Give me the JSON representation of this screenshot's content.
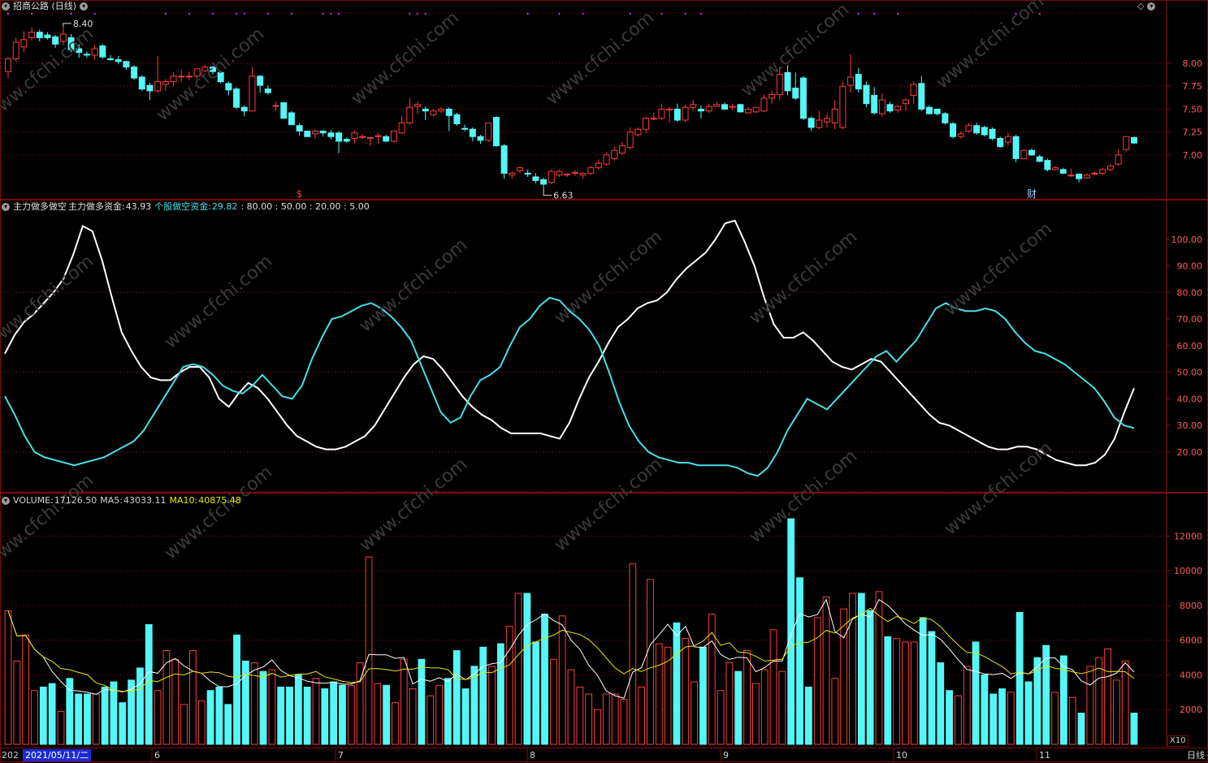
{
  "app": {
    "stock_title": "招商公路 (日线)",
    "period_tab": "日线",
    "date_prefix": "202",
    "cursor_date": "2021/05/11/二",
    "volume_multiplier": "X10",
    "month_labels": [
      "6",
      "7",
      "8",
      "9",
      "10",
      "11"
    ],
    "colors": {
      "up": "#ff3b3b",
      "down": "#54f7f7",
      "grid": "#8a1010",
      "line_white": "#ffffff",
      "ma10": "#e8e800",
      "axis_text": "#ff5a5a"
    }
  },
  "price_panel": {
    "high_label": "8.40",
    "low_label": "6.63",
    "event_marker": "$",
    "fin_marker": "财"
  },
  "indicator_panel": {
    "name": "主力做多做空",
    "s1_label": "主力做多资金:",
    "s1_value": "43.93",
    "s2_label": "个股做空资金:",
    "s2_value": "29.82",
    "levels": ": 80.00 : 50.00 : 20.00 : 5.00"
  },
  "volume_panel": {
    "label": "VOLUME:",
    "value": "17126.50",
    "ma5_label": "MA5:",
    "ma5_value": "43033.11",
    "ma10_label": "MA10:",
    "ma10_value": "40875.48"
  },
  "chart_data": [
    {
      "type": "candlestick",
      "title": "招商公路 (日线)",
      "y_ticks": [
        7.0,
        7.25,
        7.5,
        7.75,
        8.0
      ],
      "ylim": [
        6.52,
        8.55
      ],
      "annotations": {
        "high": 8.4,
        "low": 6.63
      },
      "candles": [
        [
          7.91,
          8.05,
          7.84,
          8.07
        ],
        [
          8.05,
          8.23,
          8.02,
          8.28
        ],
        [
          8.18,
          8.26,
          8.12,
          8.35
        ],
        [
          8.28,
          8.34,
          8.25,
          8.39
        ],
        [
          8.34,
          8.28,
          8.24,
          8.37
        ],
        [
          8.31,
          8.28,
          8.26,
          8.34
        ],
        [
          8.29,
          8.21,
          8.17,
          8.31
        ],
        [
          8.24,
          8.32,
          8.2,
          8.4
        ],
        [
          8.28,
          8.15,
          8.12,
          8.32
        ],
        [
          8.16,
          8.12,
          8.06,
          8.21
        ],
        [
          8.1,
          8.09,
          8.06,
          8.13
        ],
        [
          8.09,
          8.16,
          8.04,
          8.2
        ],
        [
          8.19,
          8.07,
          8.05,
          8.21
        ],
        [
          8.05,
          8.04,
          8.03,
          8.09
        ],
        [
          8.04,
          8.02,
          7.99,
          8.08
        ],
        [
          8.02,
          7.96,
          7.93,
          8.03
        ],
        [
          7.96,
          7.84,
          7.82,
          7.98
        ],
        [
          7.85,
          7.72,
          7.7,
          7.87
        ],
        [
          7.76,
          7.7,
          7.6,
          7.79
        ],
        [
          7.7,
          7.8,
          7.68,
          8.08
        ],
        [
          7.77,
          7.8,
          7.7,
          7.83
        ],
        [
          7.8,
          7.86,
          7.75,
          7.9
        ],
        [
          7.86,
          7.86,
          7.8,
          7.93
        ],
        [
          7.86,
          7.86,
          7.82,
          7.91
        ],
        [
          7.86,
          7.94,
          7.83,
          7.94
        ],
        [
          7.92,
          7.96,
          7.9,
          7.98
        ],
        [
          7.96,
          7.91,
          7.88,
          7.97
        ],
        [
          7.9,
          7.8,
          7.78,
          7.92
        ],
        [
          7.78,
          7.71,
          7.65,
          7.8
        ],
        [
          7.72,
          7.52,
          7.5,
          7.74
        ],
        [
          7.52,
          7.48,
          7.42,
          7.54
        ],
        [
          7.48,
          7.86,
          7.48,
          7.96
        ],
        [
          7.86,
          7.76,
          7.68,
          7.87
        ],
        [
          7.72,
          7.68,
          7.66,
          7.76
        ],
        [
          7.54,
          7.54,
          7.48,
          7.58
        ],
        [
          7.57,
          7.4,
          7.4,
          7.58
        ],
        [
          7.46,
          7.33,
          7.33,
          7.48
        ],
        [
          7.32,
          7.26,
          7.21,
          7.35
        ],
        [
          7.26,
          7.2,
          7.2,
          7.26
        ],
        [
          7.23,
          7.26,
          7.18,
          7.28
        ],
        [
          7.26,
          7.24,
          7.2,
          7.27
        ],
        [
          7.24,
          7.2,
          7.17,
          7.27
        ],
        [
          7.24,
          7.15,
          7.02,
          7.26
        ],
        [
          7.17,
          7.15,
          7.13,
          7.19
        ],
        [
          7.18,
          7.24,
          7.13,
          7.27
        ],
        [
          7.19,
          7.2,
          7.17,
          7.23
        ],
        [
          7.18,
          7.19,
          7.1,
          7.2
        ],
        [
          7.2,
          7.21,
          7.12,
          7.24
        ],
        [
          7.2,
          7.15,
          7.14,
          7.22
        ],
        [
          7.15,
          7.26,
          7.13,
          7.26
        ],
        [
          7.24,
          7.35,
          7.23,
          7.43
        ],
        [
          7.35,
          7.52,
          7.33,
          7.62
        ],
        [
          7.53,
          7.55,
          7.45,
          7.58
        ],
        [
          7.5,
          7.48,
          7.38,
          7.53
        ],
        [
          7.44,
          7.48,
          7.42,
          7.5
        ],
        [
          7.48,
          7.5,
          7.46,
          7.52
        ],
        [
          7.5,
          7.43,
          7.26,
          7.52
        ],
        [
          7.44,
          7.34,
          7.32,
          7.46
        ],
        [
          7.29,
          7.28,
          7.26,
          7.33
        ],
        [
          7.28,
          7.2,
          7.15,
          7.3
        ],
        [
          7.2,
          7.16,
          7.12,
          7.22
        ],
        [
          7.16,
          7.35,
          7.14,
          7.35
        ],
        [
          7.41,
          7.1,
          7.09,
          7.42
        ],
        [
          7.1,
          6.8,
          6.74,
          7.12
        ],
        [
          6.78,
          6.8,
          6.74,
          6.82
        ],
        [
          6.83,
          6.86,
          6.8,
          6.87
        ],
        [
          6.8,
          6.79,
          6.76,
          6.84
        ],
        [
          6.76,
          6.72,
          6.69,
          6.8
        ],
        [
          6.73,
          6.68,
          6.63,
          6.75
        ],
        [
          6.7,
          6.82,
          6.68,
          6.84
        ],
        [
          6.78,
          6.82,
          6.76,
          6.84
        ],
        [
          6.79,
          6.79,
          6.76,
          6.8
        ],
        [
          6.8,
          6.81,
          6.77,
          6.83
        ],
        [
          6.78,
          6.8,
          6.74,
          6.81
        ],
        [
          6.8,
          6.86,
          6.78,
          6.88
        ],
        [
          6.86,
          6.91,
          6.84,
          6.95
        ],
        [
          6.9,
          7.0,
          6.88,
          7.03
        ],
        [
          6.96,
          7.05,
          6.94,
          7.09
        ],
        [
          7.02,
          7.1,
          7.0,
          7.14
        ],
        [
          7.08,
          7.25,
          7.06,
          7.3
        ],
        [
          7.22,
          7.28,
          7.2,
          7.3
        ],
        [
          7.28,
          7.4,
          7.24,
          7.42
        ],
        [
          7.4,
          7.4,
          7.38,
          7.46
        ],
        [
          7.4,
          7.5,
          7.38,
          7.56
        ],
        [
          7.5,
          7.5,
          7.35,
          7.52
        ],
        [
          7.5,
          7.38,
          7.36,
          7.56
        ],
        [
          7.38,
          7.52,
          7.36,
          7.55
        ],
        [
          7.52,
          7.55,
          7.48,
          7.6
        ],
        [
          7.5,
          7.48,
          7.4,
          7.54
        ],
        [
          7.48,
          7.53,
          7.46,
          7.56
        ],
        [
          7.53,
          7.55,
          7.52,
          7.58
        ],
        [
          7.55,
          7.5,
          7.49,
          7.57
        ],
        [
          7.52,
          7.53,
          7.49,
          7.56
        ],
        [
          7.55,
          7.47,
          7.46,
          7.56
        ],
        [
          7.46,
          7.5,
          7.45,
          7.52
        ],
        [
          7.47,
          7.52,
          7.46,
          7.52
        ],
        [
          7.48,
          7.62,
          7.47,
          7.66
        ],
        [
          7.62,
          7.66,
          7.56,
          7.7
        ],
        [
          7.66,
          7.88,
          7.6,
          7.96
        ],
        [
          7.9,
          7.7,
          7.65,
          7.98
        ],
        [
          7.73,
          7.62,
          7.6,
          7.9
        ],
        [
          7.84,
          7.4,
          7.38,
          7.86
        ],
        [
          7.4,
          7.3,
          7.26,
          7.42
        ],
        [
          7.3,
          7.38,
          7.28,
          7.48
        ],
        [
          7.36,
          7.4,
          7.3,
          7.45
        ],
        [
          7.35,
          7.5,
          7.28,
          7.6
        ],
        [
          7.3,
          7.75,
          7.28,
          7.8
        ],
        [
          7.76,
          7.85,
          7.68,
          8.1
        ],
        [
          7.88,
          7.72,
          7.68,
          7.95
        ],
        [
          7.76,
          7.56,
          7.52,
          7.8
        ],
        [
          7.65,
          7.46,
          7.44,
          7.74
        ],
        [
          7.45,
          7.6,
          7.42,
          7.67
        ],
        [
          7.55,
          7.48,
          7.46,
          7.58
        ],
        [
          7.49,
          7.53,
          7.46,
          7.54
        ],
        [
          7.56,
          7.6,
          7.48,
          7.62
        ],
        [
          7.65,
          7.77,
          7.56,
          7.8
        ],
        [
          7.78,
          7.5,
          7.48,
          7.86
        ],
        [
          7.52,
          7.45,
          7.44,
          7.54
        ],
        [
          7.5,
          7.45,
          7.43,
          7.5
        ],
        [
          7.45,
          7.35,
          7.33,
          7.47
        ],
        [
          7.34,
          7.2,
          7.18,
          7.36
        ],
        [
          7.2,
          7.23,
          7.18,
          7.26
        ],
        [
          7.26,
          7.32,
          7.24,
          7.35
        ],
        [
          7.32,
          7.24,
          7.22,
          7.35
        ],
        [
          7.3,
          7.22,
          7.2,
          7.32
        ],
        [
          7.28,
          7.18,
          7.16,
          7.3
        ],
        [
          7.18,
          7.09,
          7.08,
          7.2
        ],
        [
          7.14,
          7.2,
          7.1,
          7.24
        ],
        [
          7.2,
          6.96,
          6.92,
          7.22
        ],
        [
          6.96,
          7.05,
          6.95,
          7.06
        ],
        [
          7.05,
          7.0,
          6.99,
          7.07
        ],
        [
          6.98,
          6.93,
          6.92,
          7.0
        ],
        [
          6.94,
          6.84,
          6.82,
          6.96
        ],
        [
          6.84,
          6.86,
          6.83,
          6.88
        ],
        [
          6.84,
          6.8,
          6.79,
          6.86
        ],
        [
          6.78,
          6.78,
          6.76,
          6.85
        ],
        [
          6.79,
          6.74,
          6.7,
          6.8
        ],
        [
          6.75,
          6.78,
          6.74,
          6.8
        ],
        [
          6.8,
          6.8,
          6.78,
          6.82
        ],
        [
          6.8,
          6.84,
          6.78,
          6.86
        ],
        [
          6.84,
          6.88,
          6.82,
          6.9
        ],
        [
          6.9,
          7.0,
          6.88,
          7.06
        ],
        [
          7.06,
          7.2,
          7.04,
          7.2
        ],
        [
          7.19,
          7.13,
          7.12,
          7.2
        ]
      ]
    },
    {
      "type": "line",
      "title": "主力做多做空",
      "y_ticks": [
        20,
        30,
        40,
        50,
        60,
        70,
        80,
        90,
        100
      ],
      "ylim": [
        5,
        110
      ],
      "reference_levels": [
        80,
        50,
        20,
        5
      ],
      "series": [
        {
          "name": "主力做多资金",
          "color": "#ffffff",
          "values": [
            57,
            64,
            69,
            72,
            76,
            80,
            85,
            94,
            105,
            103,
            92,
            78,
            65,
            58,
            52,
            48,
            47,
            47,
            50,
            52,
            52,
            48,
            40,
            37,
            42,
            46,
            44,
            40,
            35,
            30,
            26,
            24,
            22,
            21,
            21,
            22,
            24,
            26,
            30,
            36,
            42,
            48,
            53,
            56,
            55,
            51,
            46,
            41,
            37,
            34,
            32,
            29,
            27,
            27,
            27,
            27,
            26,
            25,
            31,
            40,
            48,
            54,
            61,
            67,
            70,
            74,
            76,
            77,
            80,
            85,
            89,
            92,
            95,
            100,
            106,
            107,
            99,
            90,
            78,
            68,
            63,
            63,
            65,
            62,
            58,
            54,
            52,
            51,
            53,
            55,
            54,
            50,
            46,
            42,
            38,
            34,
            31,
            30,
            28,
            26,
            24,
            22,
            21,
            21,
            22,
            22,
            21,
            19,
            17,
            16,
            15,
            15,
            16,
            19,
            25,
            35,
            44
          ]
        },
        {
          "name": "个股做空资金",
          "color": "#46e0e6",
          "values": [
            41,
            34,
            26,
            20,
            18,
            17,
            16,
            15,
            16,
            17,
            18,
            20,
            22,
            24,
            28,
            34,
            40,
            46,
            52,
            53,
            52,
            49,
            45,
            43,
            42,
            45,
            49,
            45,
            41,
            40,
            45,
            55,
            63,
            70,
            71,
            73,
            75,
            76,
            74,
            71,
            67,
            62,
            53,
            44,
            35,
            31,
            33,
            41,
            47,
            49,
            52,
            60,
            67,
            70,
            75,
            78,
            77,
            73,
            70,
            66,
            60,
            50,
            39,
            30,
            24,
            20,
            18,
            17,
            16,
            16,
            15,
            15,
            15,
            15,
            14,
            12,
            11,
            14,
            20,
            28,
            34,
            40,
            38,
            36,
            40,
            44,
            48,
            52,
            56,
            58,
            54,
            58,
            62,
            68,
            74,
            76,
            74,
            73,
            73,
            74,
            73,
            70,
            65,
            61,
            58,
            57,
            55,
            53,
            50,
            47,
            44,
            39,
            33,
            30,
            29
          ]
        }
      ]
    },
    {
      "type": "bar",
      "title": "VOLUME",
      "y_ticks": [
        2000,
        4000,
        6000,
        8000,
        10000,
        12000
      ],
      "ylim": [
        0,
        13800
      ],
      "volume": [
        7700,
        4800,
        6300,
        3100,
        3300,
        3500,
        1900,
        3800,
        2900,
        2900,
        2900,
        3300,
        3600,
        2400,
        3700,
        4400,
        6900,
        3100,
        5400,
        4900,
        2300,
        5400,
        2500,
        3100,
        3300,
        2300,
        6300,
        4800,
        4700,
        4200,
        4300,
        3300,
        3300,
        4000,
        3300,
        3800,
        3200,
        3600,
        3400,
        3400,
        4700,
        10800,
        3500,
        3400,
        2400,
        4900,
        3200,
        4900,
        2800,
        3400,
        3800,
        5400,
        3200,
        4500,
        5600,
        4500,
        5800,
        6800,
        8700,
        8700,
        5900,
        7500,
        4900,
        7400,
        4300,
        3300,
        2900,
        2000,
        2900,
        2900,
        2600,
        10400,
        3300,
        9500,
        5800,
        5600,
        7000,
        6100,
        3600,
        5600,
        7500,
        3100,
        4700,
        4200,
        5400,
        3500,
        4300,
        6600,
        4200,
        13000,
        9600,
        3300,
        7300,
        8500,
        3800,
        7800,
        8700,
        8700,
        7700,
        8800,
        6200,
        6100,
        5900,
        5900,
        7300,
        6500,
        4700,
        3100,
        2800,
        4500,
        5900,
        4000,
        2900,
        3200,
        3000,
        7600,
        3600,
        5000,
        5700,
        3000,
        5100,
        2700,
        1800,
        4500,
        5000,
        5500,
        3700,
        4800,
        1800
      ]
    }
  ]
}
